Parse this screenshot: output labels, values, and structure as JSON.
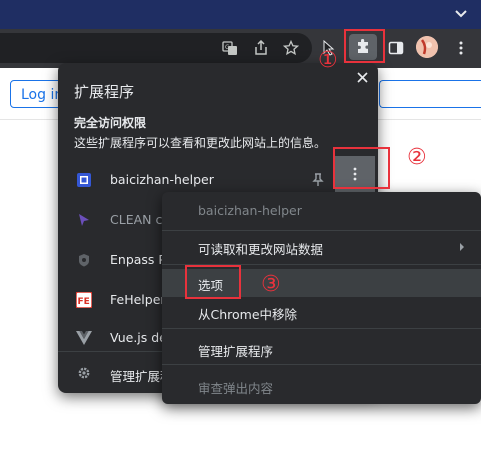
{
  "page": {
    "login_label": "Log in"
  },
  "popup": {
    "title": "扩展程序",
    "section_title": "完全访问权限",
    "section_desc": "这些扩展程序可以查看和更改此网站上的信息。",
    "extensions": [
      {
        "name": "baicizhan-helper",
        "icon": "baicizhan-icon"
      },
      {
        "name": "CLEAN c",
        "icon": "clean-crxmouse-icon"
      },
      {
        "name": "Enpass P",
        "icon": "enpass-icon"
      },
      {
        "name": "FeHelper",
        "icon": "fehelper-icon"
      },
      {
        "name": "Vue.js de",
        "icon": "vue-icon"
      }
    ],
    "manage_label": "管理扩展程"
  },
  "context_menu": {
    "header": "baicizhan-helper",
    "items": [
      {
        "label": "可读取和更改网站数据",
        "has_submenu": true
      },
      {
        "label": "选项"
      },
      {
        "label": "从Chrome中移除"
      },
      {
        "label": "管理扩展程序"
      },
      {
        "label": "审查弹出内容",
        "disabled": true
      }
    ]
  },
  "annotations": {
    "step1": "①",
    "step2": "②",
    "step3": "③"
  },
  "colors": {
    "annotation_red": "#e8323c",
    "popup_bg": "#292a2d",
    "toolbar_bg": "#35363a",
    "titlebar_bg": "#1f2e63"
  }
}
